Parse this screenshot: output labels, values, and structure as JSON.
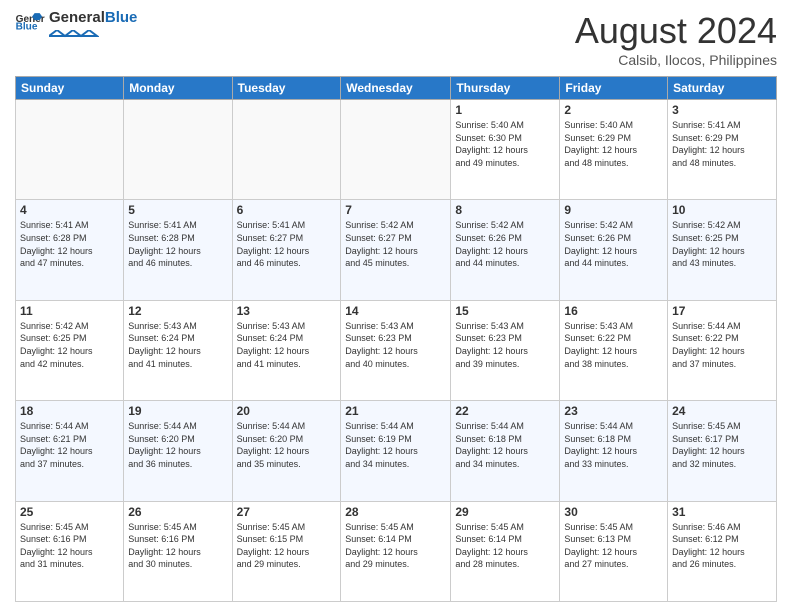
{
  "header": {
    "logo_general": "General",
    "logo_blue": "Blue",
    "month_title": "August 2024",
    "location": "Calsib, Ilocos, Philippines"
  },
  "days_of_week": [
    "Sunday",
    "Monday",
    "Tuesday",
    "Wednesday",
    "Thursday",
    "Friday",
    "Saturday"
  ],
  "weeks": [
    [
      {
        "day": "",
        "info": ""
      },
      {
        "day": "",
        "info": ""
      },
      {
        "day": "",
        "info": ""
      },
      {
        "day": "",
        "info": ""
      },
      {
        "day": "1",
        "info": "Sunrise: 5:40 AM\nSunset: 6:30 PM\nDaylight: 12 hours\nand 49 minutes."
      },
      {
        "day": "2",
        "info": "Sunrise: 5:40 AM\nSunset: 6:29 PM\nDaylight: 12 hours\nand 48 minutes."
      },
      {
        "day": "3",
        "info": "Sunrise: 5:41 AM\nSunset: 6:29 PM\nDaylight: 12 hours\nand 48 minutes."
      }
    ],
    [
      {
        "day": "4",
        "info": "Sunrise: 5:41 AM\nSunset: 6:28 PM\nDaylight: 12 hours\nand 47 minutes."
      },
      {
        "day": "5",
        "info": "Sunrise: 5:41 AM\nSunset: 6:28 PM\nDaylight: 12 hours\nand 46 minutes."
      },
      {
        "day": "6",
        "info": "Sunrise: 5:41 AM\nSunset: 6:27 PM\nDaylight: 12 hours\nand 46 minutes."
      },
      {
        "day": "7",
        "info": "Sunrise: 5:42 AM\nSunset: 6:27 PM\nDaylight: 12 hours\nand 45 minutes."
      },
      {
        "day": "8",
        "info": "Sunrise: 5:42 AM\nSunset: 6:26 PM\nDaylight: 12 hours\nand 44 minutes."
      },
      {
        "day": "9",
        "info": "Sunrise: 5:42 AM\nSunset: 6:26 PM\nDaylight: 12 hours\nand 44 minutes."
      },
      {
        "day": "10",
        "info": "Sunrise: 5:42 AM\nSunset: 6:25 PM\nDaylight: 12 hours\nand 43 minutes."
      }
    ],
    [
      {
        "day": "11",
        "info": "Sunrise: 5:42 AM\nSunset: 6:25 PM\nDaylight: 12 hours\nand 42 minutes."
      },
      {
        "day": "12",
        "info": "Sunrise: 5:43 AM\nSunset: 6:24 PM\nDaylight: 12 hours\nand 41 minutes."
      },
      {
        "day": "13",
        "info": "Sunrise: 5:43 AM\nSunset: 6:24 PM\nDaylight: 12 hours\nand 41 minutes."
      },
      {
        "day": "14",
        "info": "Sunrise: 5:43 AM\nSunset: 6:23 PM\nDaylight: 12 hours\nand 40 minutes."
      },
      {
        "day": "15",
        "info": "Sunrise: 5:43 AM\nSunset: 6:23 PM\nDaylight: 12 hours\nand 39 minutes."
      },
      {
        "day": "16",
        "info": "Sunrise: 5:43 AM\nSunset: 6:22 PM\nDaylight: 12 hours\nand 38 minutes."
      },
      {
        "day": "17",
        "info": "Sunrise: 5:44 AM\nSunset: 6:22 PM\nDaylight: 12 hours\nand 37 minutes."
      }
    ],
    [
      {
        "day": "18",
        "info": "Sunrise: 5:44 AM\nSunset: 6:21 PM\nDaylight: 12 hours\nand 37 minutes."
      },
      {
        "day": "19",
        "info": "Sunrise: 5:44 AM\nSunset: 6:20 PM\nDaylight: 12 hours\nand 36 minutes."
      },
      {
        "day": "20",
        "info": "Sunrise: 5:44 AM\nSunset: 6:20 PM\nDaylight: 12 hours\nand 35 minutes."
      },
      {
        "day": "21",
        "info": "Sunrise: 5:44 AM\nSunset: 6:19 PM\nDaylight: 12 hours\nand 34 minutes."
      },
      {
        "day": "22",
        "info": "Sunrise: 5:44 AM\nSunset: 6:18 PM\nDaylight: 12 hours\nand 34 minutes."
      },
      {
        "day": "23",
        "info": "Sunrise: 5:44 AM\nSunset: 6:18 PM\nDaylight: 12 hours\nand 33 minutes."
      },
      {
        "day": "24",
        "info": "Sunrise: 5:45 AM\nSunset: 6:17 PM\nDaylight: 12 hours\nand 32 minutes."
      }
    ],
    [
      {
        "day": "25",
        "info": "Sunrise: 5:45 AM\nSunset: 6:16 PM\nDaylight: 12 hours\nand 31 minutes."
      },
      {
        "day": "26",
        "info": "Sunrise: 5:45 AM\nSunset: 6:16 PM\nDaylight: 12 hours\nand 30 minutes."
      },
      {
        "day": "27",
        "info": "Sunrise: 5:45 AM\nSunset: 6:15 PM\nDaylight: 12 hours\nand 29 minutes."
      },
      {
        "day": "28",
        "info": "Sunrise: 5:45 AM\nSunset: 6:14 PM\nDaylight: 12 hours\nand 29 minutes."
      },
      {
        "day": "29",
        "info": "Sunrise: 5:45 AM\nSunset: 6:14 PM\nDaylight: 12 hours\nand 28 minutes."
      },
      {
        "day": "30",
        "info": "Sunrise: 5:45 AM\nSunset: 6:13 PM\nDaylight: 12 hours\nand 27 minutes."
      },
      {
        "day": "31",
        "info": "Sunrise: 5:46 AM\nSunset: 6:12 PM\nDaylight: 12 hours\nand 26 minutes."
      }
    ]
  ]
}
